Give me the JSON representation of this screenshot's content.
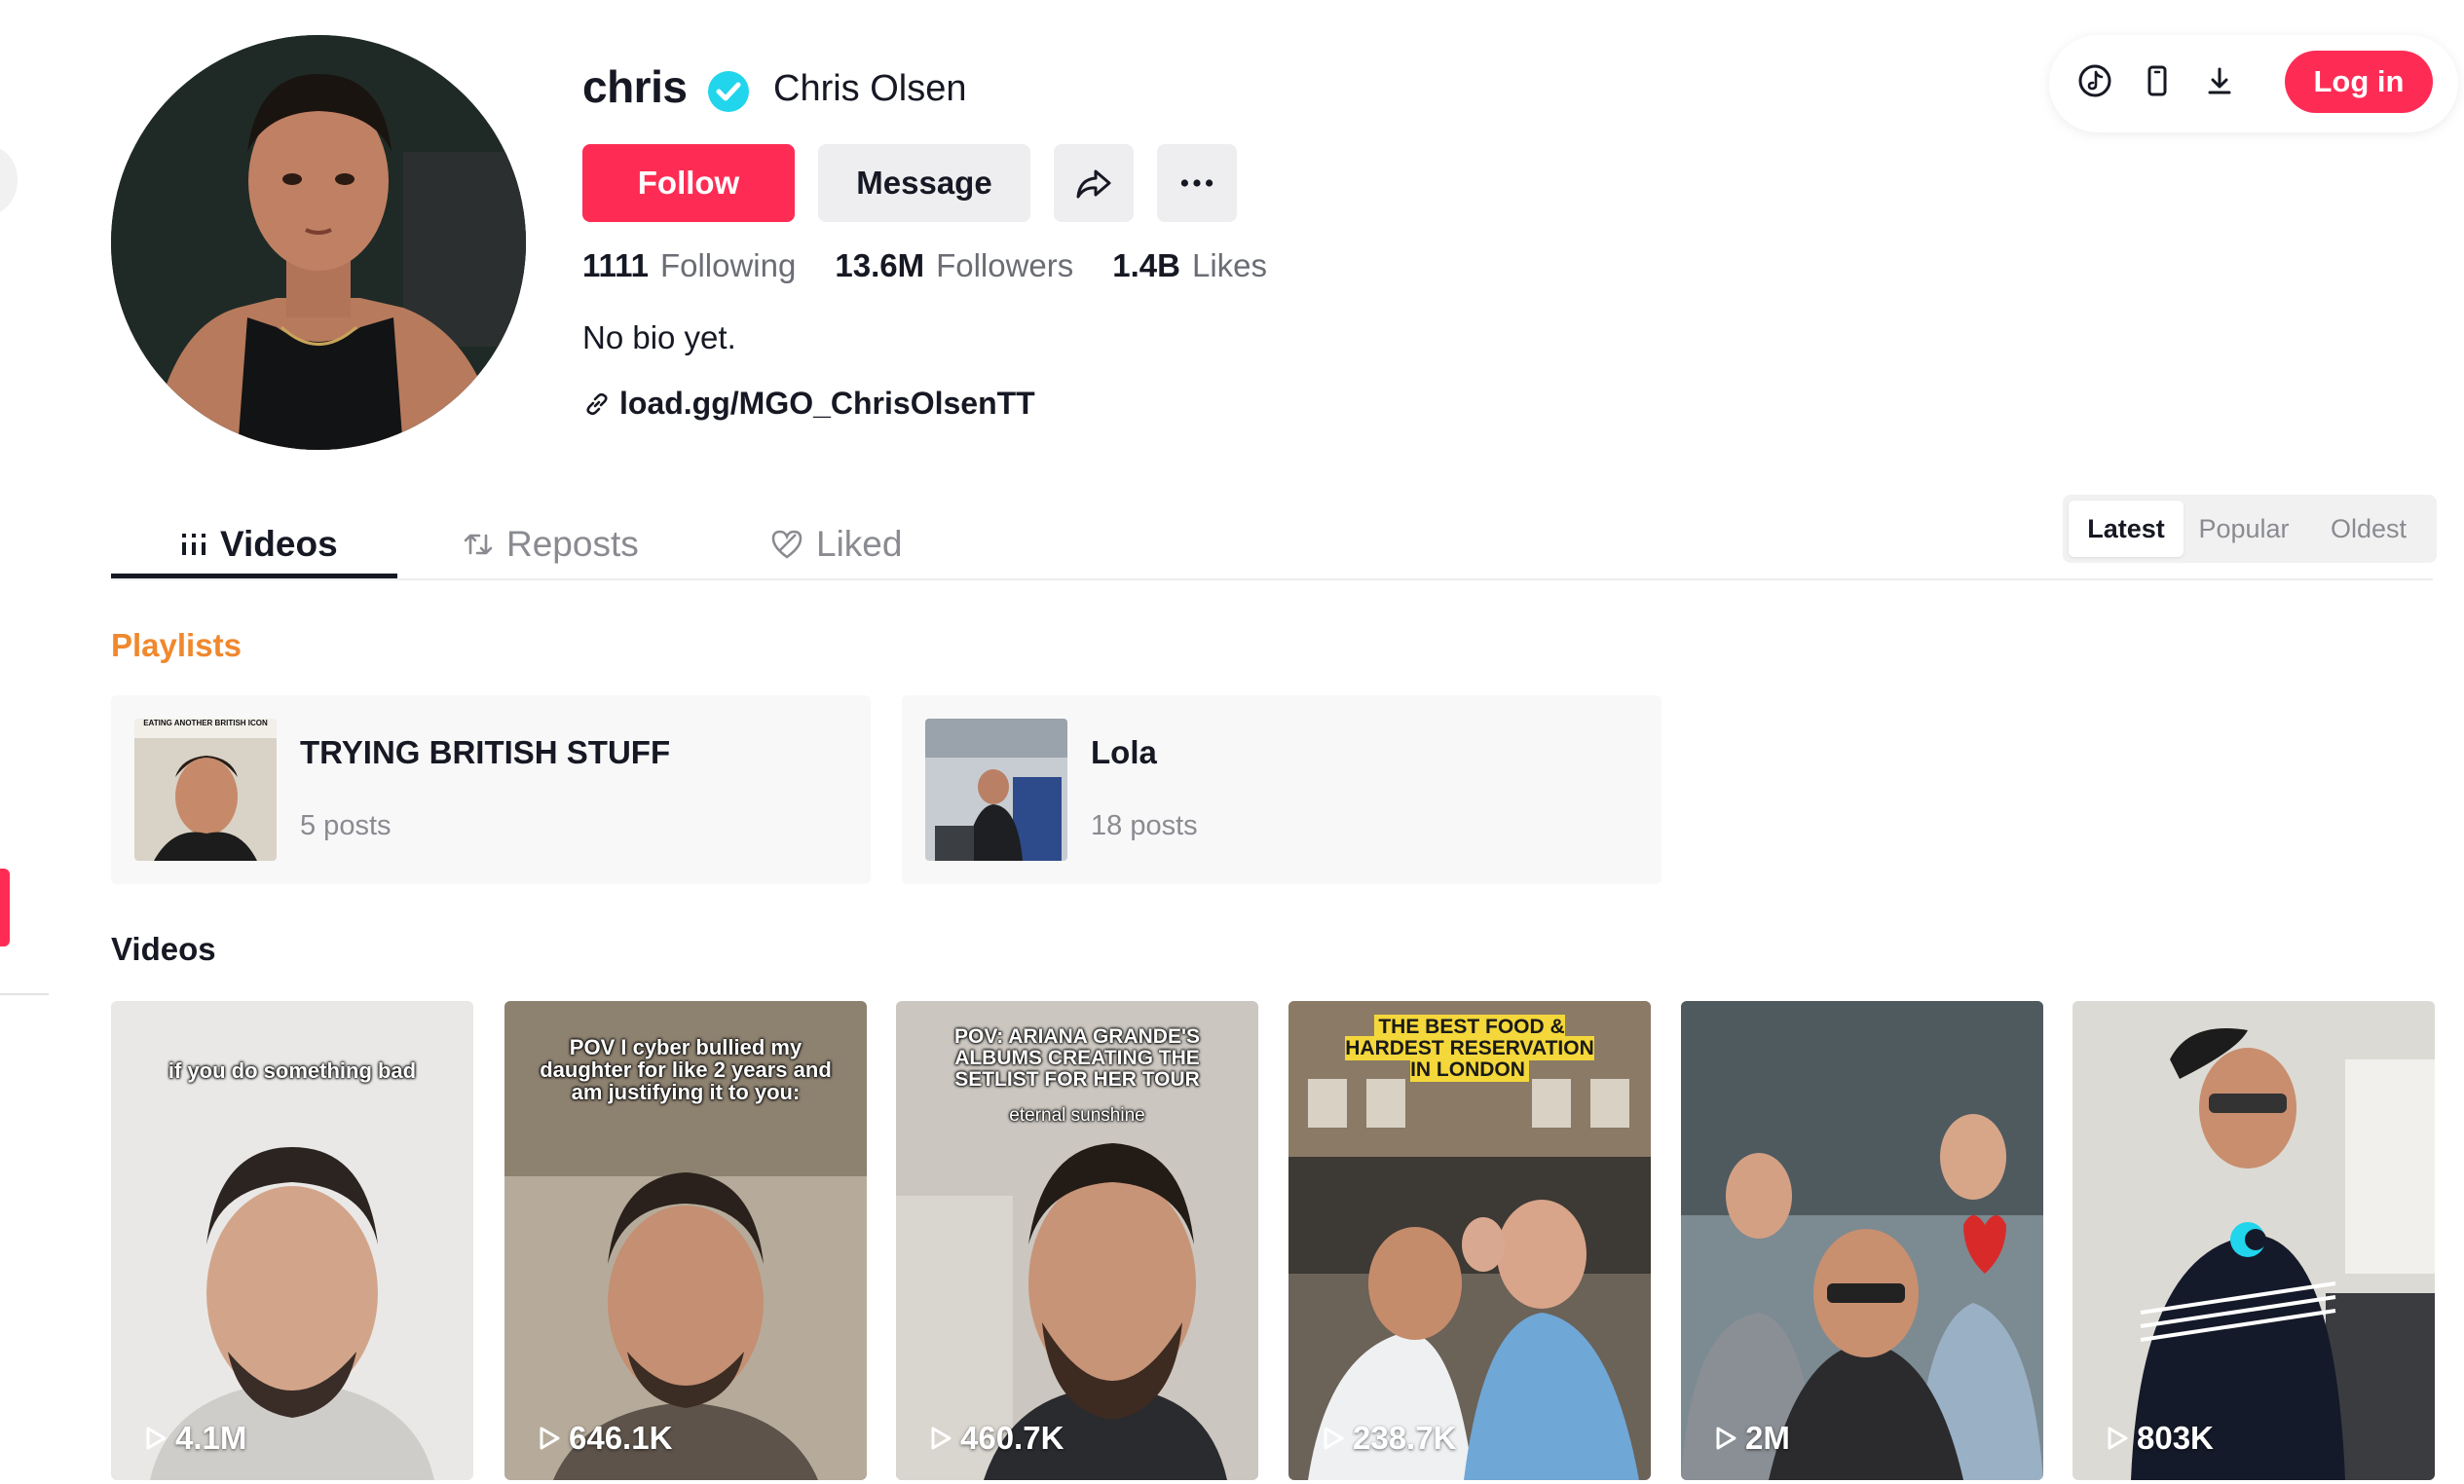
{
  "profile": {
    "username": "chris",
    "display_name": "Chris Olsen",
    "follow_label": "Follow",
    "message_label": "Message",
    "bio": "No bio yet.",
    "link": "load.gg/MGO_ChrisOlsenTT"
  },
  "stats": [
    {
      "value": "1111",
      "label": "Following"
    },
    {
      "value": "13.6M",
      "label": "Followers"
    },
    {
      "value": "1.4B",
      "label": "Likes"
    }
  ],
  "topbar": {
    "login_label": "Log in"
  },
  "tabs": [
    {
      "label": "Videos"
    },
    {
      "label": "Reposts"
    },
    {
      "label": "Liked"
    }
  ],
  "sort": [
    "Latest",
    "Popular",
    "Oldest"
  ],
  "playlists": {
    "title": "Playlists",
    "items": [
      {
        "name": "TRYING BRITISH STUFF",
        "count": "5 posts",
        "thumb_caption": "EATING ANOTHER BRITISH ICON"
      },
      {
        "name": "Lola",
        "count": "18 posts"
      }
    ]
  },
  "videos": {
    "title": "Videos",
    "items": [
      {
        "caption": "if you do something bad",
        "views": "4.1M"
      },
      {
        "caption": "POV I cyber bullied my daughter for like 2 years and am justifying it to you:",
        "views": "646.1K"
      },
      {
        "caption": "POV: ARIANA GRANDE'S ALBUMS CREATING THE SETLIST FOR HER TOUR",
        "caption2": "eternal sunshine",
        "views": "460.7K"
      },
      {
        "caption": "THE BEST FOOD & HARDEST RESERVATION IN LONDON",
        "views": "238.7K"
      },
      {
        "caption": "",
        "views": "2M"
      },
      {
        "caption": "",
        "views": "803K"
      }
    ]
  },
  "colors": {
    "brand": "#fe2c55",
    "verified": "#20d5ec",
    "playlists_heading": "#f0882e",
    "caption_highlight": "#f4d73a"
  },
  "icons": [
    "verified-icon",
    "share-icon",
    "more-icon",
    "link-icon",
    "tiktok-icon",
    "phone-icon",
    "download-icon",
    "grid-icon",
    "repost-icon",
    "heart-icon",
    "play-icon"
  ]
}
